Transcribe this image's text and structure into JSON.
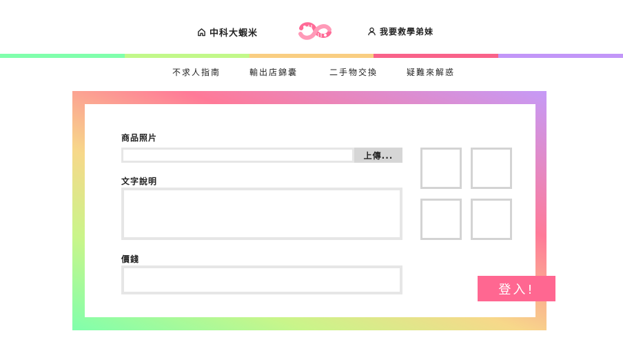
{
  "header": {
    "home_label": "中科大蝦米",
    "home_icon": "home-icon",
    "logo_icon": "shrimp-logo-icon",
    "user_label": "我要救學弟妹",
    "user_icon": "user-icon"
  },
  "stripe_colors": [
    "#80ffac",
    "#c2f88a",
    "#f9ce82",
    "#f9628a",
    "#c296f8"
  ],
  "nav": {
    "items": [
      {
        "label": "不求人指南"
      },
      {
        "label": "輸出店錦囊"
      },
      {
        "label": "二手物交換"
      },
      {
        "label": "疑難來解惑"
      }
    ]
  },
  "form": {
    "photo_label": "商品照片",
    "photo_value": "",
    "upload_label": "上傳...",
    "description_label": "文字說明",
    "description_value": "",
    "price_label": "價錢",
    "price_value": "",
    "thumbnails_count": 4
  },
  "login_label": "登入!",
  "colors": {
    "accent": "#ff6791",
    "field_border": "#e6e6e6",
    "upload_bg": "#d6d6d6"
  }
}
